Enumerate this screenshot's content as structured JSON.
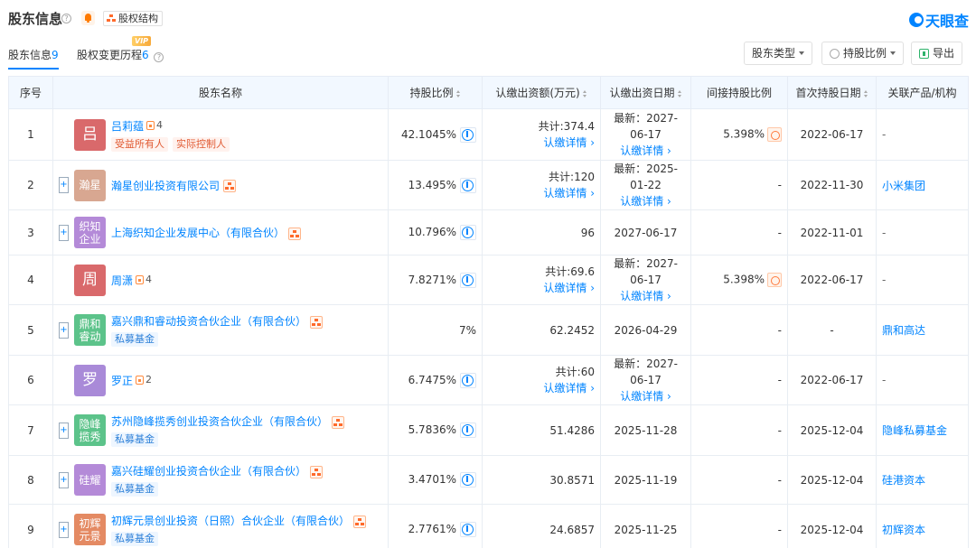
{
  "header": {
    "title": "股东信息",
    "equity_label": "股权结构",
    "logo_text": "天眼查"
  },
  "tabs": [
    {
      "label": "股东信息",
      "count": "9"
    },
    {
      "label": "股权变更历程",
      "count": "6",
      "badge": "VIP"
    }
  ],
  "toolbar": {
    "type_label": "股东类型",
    "ratio_label": "持股比例",
    "export_label": "导出"
  },
  "columns": {
    "index": "序号",
    "name": "股东名称",
    "ratio": "持股比例",
    "capital": "认缴出资额(万元)",
    "date": "认缴出资日期",
    "indirect": "间接持股比例",
    "first_date": "首次持股日期",
    "related": "关联产品/机构"
  },
  "common": {
    "detail_link": "认缴详情 ›"
  },
  "rows": [
    {
      "index": "1",
      "avatar": "吕",
      "avatar_color": "#d9696b",
      "name": "吕莉蕴",
      "rel_count": "4",
      "tags": [
        "受益所有人",
        "实际控制人"
      ],
      "ratio": "42.1045%",
      "capital": "共计:374.4",
      "capital_detail": true,
      "date": "最新：2027-06-17",
      "date_detail": true,
      "indirect": "5.398%",
      "first_date": "2022-06-17",
      "related": "-"
    },
    {
      "index": "2",
      "avatar": "瀚星",
      "avatar_color": "#d8a791",
      "name": "瀚星创业投资有限公司",
      "org": true,
      "expand": true,
      "ratio": "13.495%",
      "capital": "共计:120",
      "capital_detail": true,
      "date": "最新：2025-01-22",
      "date_detail": true,
      "indirect": "-",
      "first_date": "2022-11-30",
      "related": "小米集团"
    },
    {
      "index": "3",
      "avatar": "织知企业",
      "avatar_color": "#b48ad8",
      "name": "上海织知企业发展中心（有限合伙）",
      "org": true,
      "expand": true,
      "ratio": "10.796%",
      "capital": "96",
      "date": "2027-06-17",
      "indirect": "-",
      "first_date": "2022-11-01",
      "related": "-"
    },
    {
      "index": "4",
      "avatar": "周",
      "avatar_color": "#d9696b",
      "name": "周潇",
      "rel_count": "4",
      "ratio": "7.8271%",
      "capital": "共计:69.6",
      "capital_detail": true,
      "date": "最新：2027-06-17",
      "date_detail": true,
      "indirect": "5.398%",
      "first_date": "2022-06-17",
      "related": "-"
    },
    {
      "index": "5",
      "avatar": "鼎和睿动",
      "avatar_color": "#5cc38a",
      "name": "嘉兴鼎和睿动投资合伙企业（有限合伙）",
      "org": true,
      "expand": true,
      "tags_blue": [
        "私募基金"
      ],
      "ratio": "7%",
      "capital": "62.2452",
      "date": "2026-04-29",
      "indirect": "-",
      "first_date": "-",
      "related": "鼎和高达"
    },
    {
      "index": "6",
      "avatar": "罗",
      "avatar_color": "#a98ad8",
      "name": "罗正",
      "rel_count": "2",
      "ratio": "6.7475%",
      "capital": "共计:60",
      "capital_detail": true,
      "date": "最新：2027-06-17",
      "date_detail": true,
      "indirect": "-",
      "first_date": "2022-06-17",
      "related": "-"
    },
    {
      "index": "7",
      "avatar": "隐峰揽秀",
      "avatar_color": "#5cc38a",
      "name": "苏州隐峰揽秀创业投资合伙企业（有限合伙）",
      "org": true,
      "expand": true,
      "tags_blue": [
        "私募基金"
      ],
      "ratio": "5.7836%",
      "capital": "51.4286",
      "date": "2025-11-28",
      "indirect": "-",
      "first_date": "2025-12-04",
      "related": "隐峰私募基金"
    },
    {
      "index": "8",
      "avatar": "硅耀",
      "avatar_color": "#b48ad8",
      "name": "嘉兴硅耀创业投资合伙企业（有限合伙）",
      "org": true,
      "expand": true,
      "tags_blue": [
        "私募基金"
      ],
      "ratio": "3.4701%",
      "capital": "30.8571",
      "date": "2025-11-19",
      "indirect": "-",
      "first_date": "2025-12-04",
      "related": "硅港资本"
    },
    {
      "index": "9",
      "avatar": "初辉元景",
      "avatar_color": "#e48a63",
      "name": "初辉元景创业投资（日照）合伙企业（有限合伙）",
      "org": true,
      "expand": true,
      "tags_blue": [
        "私募基金"
      ],
      "ratio": "2.7761%",
      "capital": "24.6857",
      "date": "2025-11-25",
      "indirect": "-",
      "first_date": "2025-12-04",
      "related": "初辉资本"
    }
  ]
}
